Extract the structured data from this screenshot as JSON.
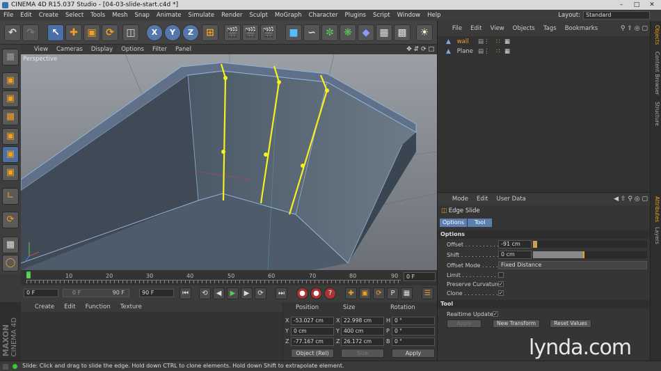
{
  "window": {
    "title": "CINEMA 4D R15.037 Studio - [04-03-slide-start.c4d *]",
    "minimize": "–",
    "maximize": "□",
    "close": "✕"
  },
  "menubar": {
    "items": [
      "File",
      "Edit",
      "Create",
      "Select",
      "Tools",
      "Mesh",
      "Snap",
      "Animate",
      "Simulate",
      "Render",
      "Sculpt",
      "MoGraph",
      "Character",
      "Plugins",
      "Script",
      "Window",
      "Help"
    ],
    "layout_label": "Layout:",
    "layout_value": "Standard"
  },
  "toolbar": {
    "x_axis": "X",
    "y_axis": "Y",
    "z_axis": "Z"
  },
  "viewport": {
    "menu": [
      "View",
      "Cameras",
      "Display",
      "Options",
      "Filter",
      "Panel"
    ],
    "label": "Perspective"
  },
  "timeline": {
    "ticks": [
      "0",
      "10",
      "20",
      "30",
      "40",
      "50",
      "60",
      "70",
      "80",
      "90"
    ],
    "current_frame": "0 F"
  },
  "transport": {
    "start_frame": "0 F",
    "current_frame": "0 F",
    "end_frame_slider": "90 F",
    "end_frame": "90 F"
  },
  "materials": {
    "menu": [
      "Create",
      "Edit",
      "Function",
      "Texture"
    ]
  },
  "coordinates": {
    "headers": {
      "position": "Position",
      "size": "Size",
      "rotation": "Rotation"
    },
    "rows": [
      {
        "axis": "X",
        "position": "-53.027 cm",
        "size_axis": "X",
        "size": "22.998 cm",
        "rot_axis": "H",
        "rotation": "0 °"
      },
      {
        "axis": "Y",
        "position": "0 cm",
        "size_axis": "Y",
        "size": "400 cm",
        "rot_axis": "P",
        "rotation": "0 °"
      },
      {
        "axis": "Z",
        "position": "-77.167 cm",
        "size_axis": "Z",
        "size": "26.172 cm",
        "rot_axis": "B",
        "rotation": "0 °"
      }
    ],
    "mode": "Object (Rel)",
    "size_mode": "Size",
    "apply": "Apply"
  },
  "logo": {
    "brand": "MAXON",
    "product": "CINEMA 4D"
  },
  "status": {
    "text": "Slide: Click and drag to slide the edge. Hold down CTRL to clone elements. Hold down Shift to extrapolate element."
  },
  "objects": {
    "menu": [
      "File",
      "Edit",
      "View",
      "Objects",
      "Tags",
      "Bookmarks"
    ],
    "items": [
      {
        "name": "wall",
        "color": "#f2a020"
      },
      {
        "name": "Plane",
        "color": "#cccccc"
      }
    ]
  },
  "sidetabs": {
    "top": [
      "Objects",
      "Content Browser",
      "Structure"
    ],
    "bottom": [
      "Attributes",
      "Layers"
    ]
  },
  "attributes": {
    "menu": [
      "Mode",
      "Edit",
      "User Data"
    ],
    "tool_name": "Edge Slide",
    "tabs": [
      "Options",
      "Tool"
    ],
    "options_header": "Options",
    "offset_label": "Offset . . . . . . . . . .",
    "offset_value": "-91 cm",
    "shift_label": "Shift . . . . . . . . . . .",
    "shift_value": "0 cm",
    "shift_level": 0.45,
    "offset_mode_label": "Offset Mode . . . . . .",
    "offset_mode_value": "Fixed Distance",
    "limit_label": "Limit . . . . . . . . . . .",
    "limit_checked": false,
    "preserve_label": "Preserve Curvature",
    "preserve_checked": true,
    "clone_label": "Clone . . . . . . . . . .",
    "clone_checked": true,
    "tool_header": "Tool",
    "realtime_label": "Realtime Update",
    "realtime_checked": true,
    "apply_btn": "Apply",
    "new_transform_btn": "New Transform",
    "reset_btn": "Reset Values"
  },
  "watermark": "lynda.com"
}
